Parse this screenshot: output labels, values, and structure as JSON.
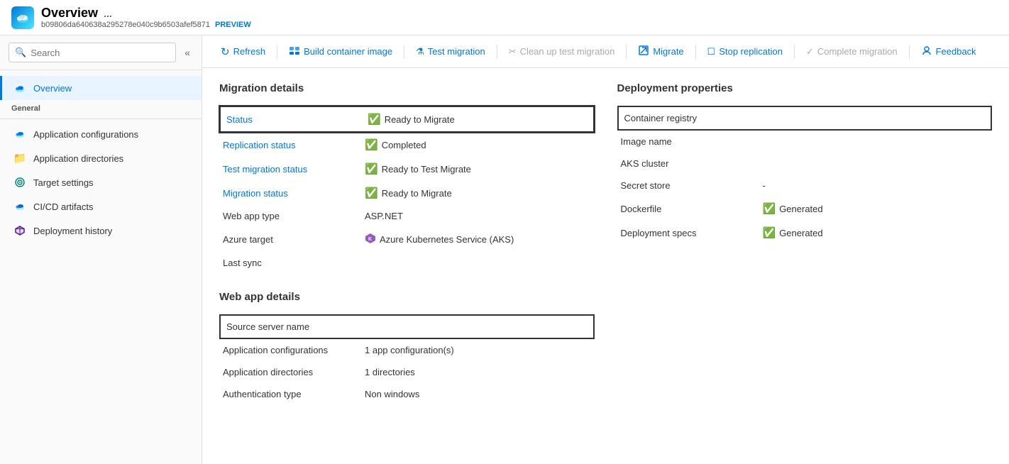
{
  "app": {
    "logo_char": "☁",
    "title": "Overview",
    "ellipsis": "...",
    "subtitle": "b09806da640638a295278e040c9b6503afef5871",
    "preview_label": "PREVIEW"
  },
  "sidebar": {
    "search_placeholder": "Search",
    "collapse_icon": "«",
    "overview_label": "Overview",
    "general_label": "General",
    "items": [
      {
        "id": "app-configs",
        "label": "Application configurations",
        "icon": "cloud",
        "icon_char": "☁"
      },
      {
        "id": "app-dirs",
        "label": "Application directories",
        "icon": "folder",
        "icon_char": "📁"
      },
      {
        "id": "target-settings",
        "label": "Target settings",
        "icon": "settings",
        "icon_char": "⚙"
      },
      {
        "id": "cicd",
        "label": "CI/CD artifacts",
        "icon": "cloud2",
        "icon_char": "☁"
      },
      {
        "id": "deploy-history",
        "label": "Deployment history",
        "icon": "cube",
        "icon_char": "⬡"
      }
    ]
  },
  "toolbar": {
    "buttons": [
      {
        "id": "refresh",
        "label": "Refresh",
        "icon": "↻",
        "enabled": true
      },
      {
        "id": "build-container",
        "label": "Build container image",
        "icon": "⊞",
        "enabled": true
      },
      {
        "id": "test-migration",
        "label": "Test migration",
        "icon": "⚗",
        "enabled": true
      },
      {
        "id": "clean-up",
        "label": "Clean up test migration",
        "icon": "✂",
        "enabled": false
      },
      {
        "id": "migrate",
        "label": "Migrate",
        "icon": "↗",
        "enabled": true
      },
      {
        "id": "stop-replication",
        "label": "Stop replication",
        "icon": "☐",
        "enabled": true
      },
      {
        "id": "complete-migration",
        "label": "Complete migration",
        "icon": "✓",
        "enabled": false
      },
      {
        "id": "feedback",
        "label": "Feedback",
        "icon": "👤",
        "enabled": true
      }
    ]
  },
  "migration_details": {
    "section_title": "Migration details",
    "rows": [
      {
        "id": "status",
        "label": "Status",
        "value": "Ready to Migrate",
        "type": "status-check",
        "is_link": false,
        "bordered": true
      },
      {
        "id": "replication-status",
        "label": "Replication status",
        "value": "Completed",
        "type": "status-check",
        "is_link": true
      },
      {
        "id": "test-migration-status",
        "label": "Test migration status",
        "value": "Ready to Test Migrate",
        "type": "status-check",
        "is_link": true
      },
      {
        "id": "migration-status",
        "label": "Migration status",
        "value": "Ready to Migrate",
        "type": "status-check",
        "is_link": true
      },
      {
        "id": "web-app-type",
        "label": "Web app type",
        "value": "ASP.NET",
        "type": "text",
        "is_link": false
      },
      {
        "id": "azure-target",
        "label": "Azure target",
        "value": "Azure Kubernetes Service (AKS)",
        "type": "aks",
        "is_link": false
      },
      {
        "id": "last-sync",
        "label": "Last sync",
        "value": "",
        "type": "text",
        "is_link": false
      }
    ]
  },
  "web_app_details": {
    "section_title": "Web app details",
    "rows": [
      {
        "id": "source-server",
        "label": "Source server name",
        "value": ""
      },
      {
        "id": "app-configs",
        "label": "Application configurations",
        "value": "1 app configuration(s)"
      },
      {
        "id": "app-dirs",
        "label": "Application directories",
        "value": "1 directories"
      },
      {
        "id": "auth-type",
        "label": "Authentication type",
        "value": "Non windows"
      }
    ]
  },
  "deployment_properties": {
    "section_title": "Deployment properties",
    "rows": [
      {
        "id": "container-registry",
        "label": "Container registry",
        "value": "",
        "type": "text"
      },
      {
        "id": "image-name",
        "label": "Image name",
        "value": "",
        "type": "text"
      },
      {
        "id": "aks-cluster",
        "label": "AKS cluster",
        "value": "",
        "type": "text"
      },
      {
        "id": "secret-store",
        "label": "Secret store",
        "value": "-",
        "type": "text"
      },
      {
        "id": "dockerfile",
        "label": "Dockerfile",
        "value": "Generated",
        "type": "status-check"
      },
      {
        "id": "deployment-specs",
        "label": "Deployment specs",
        "value": "Generated",
        "type": "status-check"
      }
    ]
  }
}
